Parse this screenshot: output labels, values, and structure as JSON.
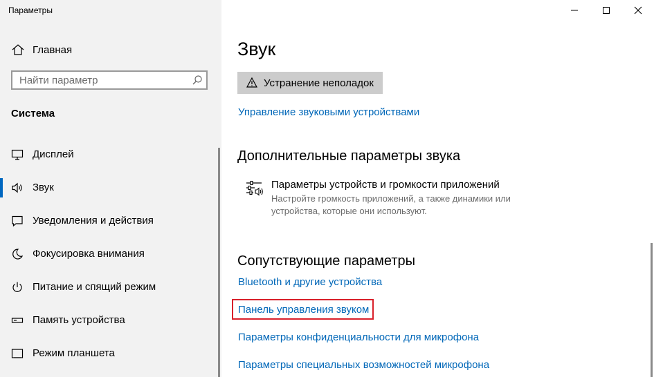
{
  "app": {
    "title": "Параметры"
  },
  "sidebar": {
    "home_label": "Главная",
    "search_placeholder": "Найти параметр",
    "section_title": "Система",
    "items": [
      {
        "label": "Дисплей",
        "icon": "display-icon",
        "active": false
      },
      {
        "label": "Звук",
        "icon": "speaker-icon",
        "active": true
      },
      {
        "label": "Уведомления и действия",
        "icon": "notification-icon",
        "active": false
      },
      {
        "label": "Фокусировка внимания",
        "icon": "moon-icon",
        "active": false
      },
      {
        "label": "Питание и спящий режим",
        "icon": "power-icon",
        "active": false
      },
      {
        "label": "Память устройства",
        "icon": "storage-icon",
        "active": false
      },
      {
        "label": "Режим планшета",
        "icon": "tablet-icon",
        "active": false
      }
    ]
  },
  "main": {
    "title": "Звук",
    "troubleshoot_label": "Устранение неполадок",
    "manage_devices_link": "Управление звуковыми устройствами",
    "advanced": {
      "heading": "Дополнительные параметры звука",
      "app_volume_title": "Параметры устройств и громкости приложений",
      "app_volume_desc": "Настройте громкость приложений, а также динамики или устройства, которые они используют."
    },
    "related": {
      "heading": "Сопутствующие параметры",
      "links": [
        "Bluetooth и другие устройства",
        "Панель управления звуком",
        "Параметры конфиденциальности для микрофона",
        "Параметры специальных возможностей микрофона"
      ]
    }
  },
  "colors": {
    "accent": "#0067c0",
    "link": "#0067b8",
    "highlight": "#d9202a",
    "sidebar_bg": "#f2f2f2"
  }
}
